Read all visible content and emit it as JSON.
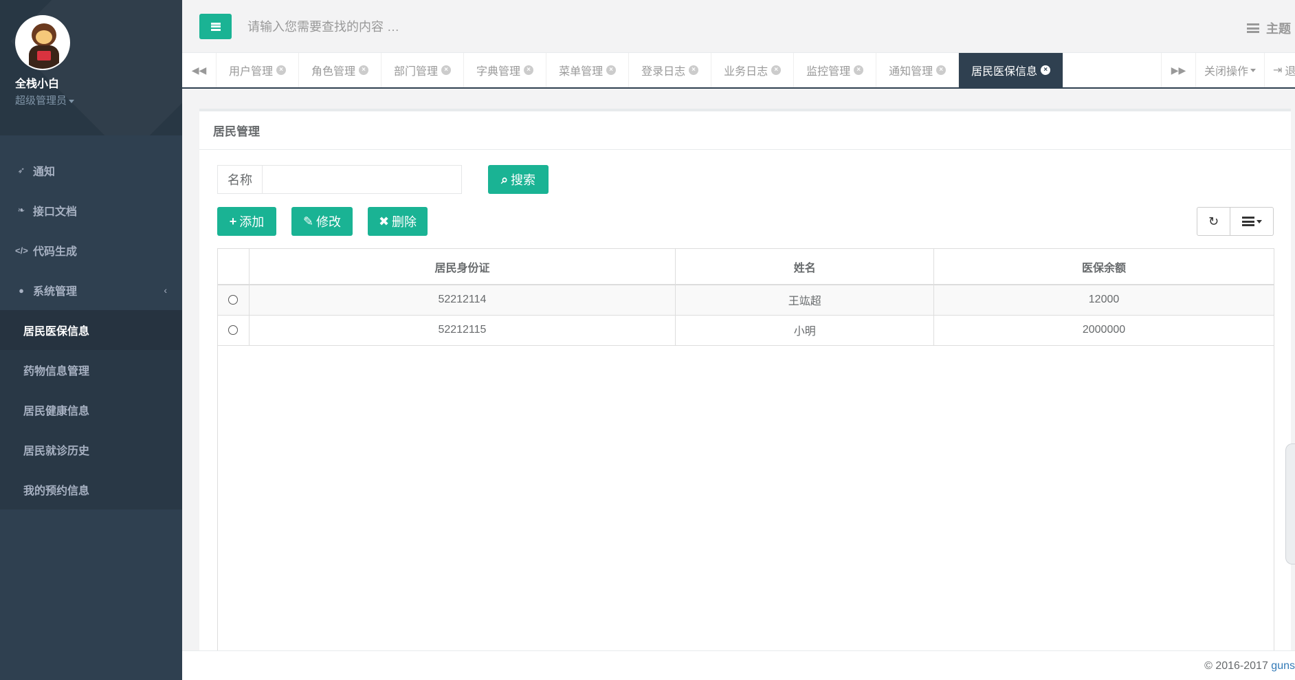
{
  "sidebar": {
    "profile": {
      "name": "全栈小白",
      "role": "超级管理员"
    },
    "items": [
      {
        "label": "通知",
        "icon": "rocket-icon"
      },
      {
        "label": "接口文档",
        "icon": "leaf-icon"
      },
      {
        "label": "代码生成",
        "icon": "code-icon"
      },
      {
        "label": "系统管理",
        "icon": "user-icon",
        "arrow": "‹"
      }
    ],
    "subitems": [
      {
        "label": "居民医保信息",
        "active": true
      },
      {
        "label": "药物信息管理"
      },
      {
        "label": "居民健康信息"
      },
      {
        "label": "居民就诊历史"
      },
      {
        "label": "我的预约信息"
      }
    ]
  },
  "header": {
    "search_placeholder": "请输入您需要查找的内容 …",
    "theme_label": "主题"
  },
  "tabs": {
    "items": [
      "用户管理",
      "角色管理",
      "部门管理",
      "字典管理",
      "菜单管理",
      "登录日志",
      "业务日志",
      "监控管理",
      "通知管理",
      "居民医保信息"
    ],
    "active_index": 9,
    "close_ops_label": "关闭操作",
    "exit_label": "退出"
  },
  "panel": {
    "title": "居民管理",
    "search_label": "名称",
    "search_button": "搜索",
    "add_button": "添加",
    "edit_button": "修改",
    "delete_button": "删除"
  },
  "table": {
    "headers": [
      "居民身份证",
      "姓名",
      "医保余额"
    ],
    "rows": [
      [
        "52212114",
        "王竑超",
        "12000"
      ],
      [
        "52212115",
        "小明",
        "2000000"
      ]
    ]
  },
  "footer": {
    "copyright": "© 2016-2017 ",
    "link": "guns"
  },
  "colors": {
    "sidebar_bg": "#2f4050",
    "accent": "#1ab394"
  }
}
